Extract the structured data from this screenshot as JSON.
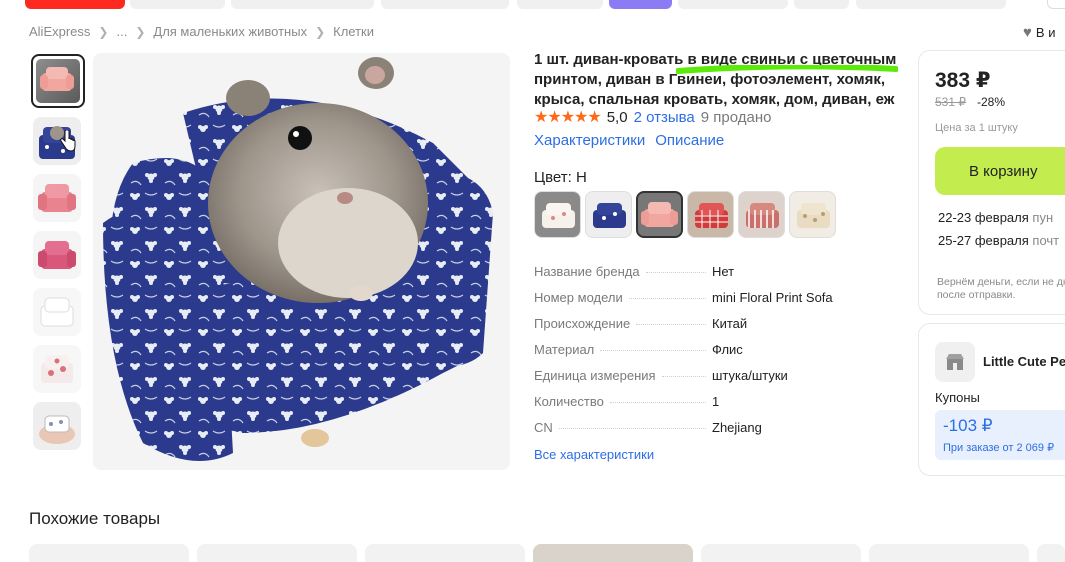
{
  "breadcrumb": {
    "items": [
      "AliExpress",
      "...",
      "Для маленьких животных",
      "Клетки"
    ]
  },
  "wishlist": {
    "label": "В и"
  },
  "product": {
    "title": "1 шт. диван-кровать в виде свиньи с цветочным принтом, диван в Гвинеи, фотоэлемент, хомяк, крыса, спальная кровать, хомяк, дом, диван, еж",
    "stars": "★★★★★",
    "rating": "5,0",
    "reviews": "2 отзыва",
    "sold": "9 продано",
    "tabs": [
      "Характеристики",
      "Описание"
    ],
    "color_label": "Цвет: H",
    "swatch_count": 6,
    "selected_swatch": 3,
    "specs": [
      {
        "key": "Название бренда",
        "value": "Нет"
      },
      {
        "key": "Номер модели",
        "value": "mini Floral Print Sofa"
      },
      {
        "key": "Происхождение",
        "value": "Китай"
      },
      {
        "key": "Материал",
        "value": "Флис"
      },
      {
        "key": "Единица измерения",
        "value": "штука/штуки"
      },
      {
        "key": "Количество",
        "value": "1"
      },
      {
        "key": "CN",
        "value": "Zhejiang"
      }
    ],
    "all_specs_link": "Все характеристики"
  },
  "buy": {
    "price": "383 ₽",
    "old_price": "531 ₽",
    "discount": "-28%",
    "unit_price": "Цена за 1 штуку",
    "cart_button": "В корзину",
    "delivery": [
      {
        "date": "22-23 февраля",
        "type": "пун"
      },
      {
        "date": "25-27 февраля",
        "type": "почт"
      }
    ],
    "refund": "Вернём деньги, если не дней после отправки."
  },
  "store": {
    "name": "Little Cute Pe",
    "coupons_label": "Купоны",
    "coupon_value": "-103 ₽",
    "coupon_condition": "При заказе от 2 069 ₽"
  },
  "similar": {
    "title": "Похожие товары"
  },
  "colors": {
    "accent_green": "#c3ec4e",
    "link_blue": "#2d6ee6",
    "star_orange": "#ff6a1a",
    "highlight_green": "#5bea0a",
    "sofa_navy": "#2b3a8c"
  }
}
